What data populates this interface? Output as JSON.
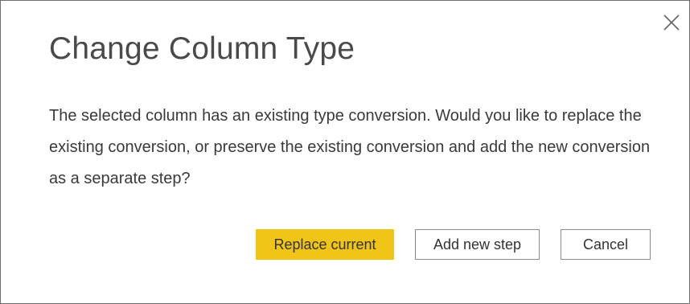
{
  "dialog": {
    "title": "Change Column Type",
    "message": "The selected column has an existing type conversion. Would you like to replace the existing conversion, or preserve the existing conversion and add the new conversion as a separate step?",
    "close_icon": "close-icon",
    "buttons": {
      "replace_label": "Replace current",
      "add_label": "Add new step",
      "cancel_label": "Cancel"
    }
  },
  "colors": {
    "primary_button": "#f0c518",
    "title_text": "#4a4a4a",
    "body_text": "#3a3a3a",
    "border": "#6e6e6e"
  }
}
